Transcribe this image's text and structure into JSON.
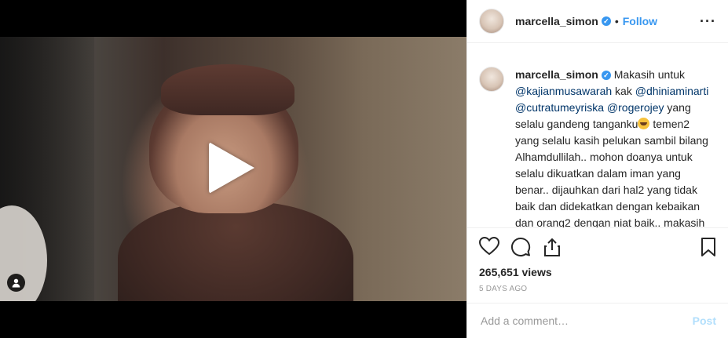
{
  "post": {
    "username": "marcella_simon",
    "follow_label": "Follow",
    "separator": "•",
    "more_label": "···",
    "caption_prefix": "Makasih untuk",
    "mentions": [
      "@kajianmusawarah",
      "@dhiniaminarti",
      "@cutratumeyriska",
      "@rogerojey"
    ],
    "caption_kak": "kak",
    "caption_mid": "yang selalu gandeng tanganku",
    "caption_rest": "temen2 yang selalu kasih pelukan sambil bilang Alhamdullilah.. mohon doanya untuk selalu dikuatkan dalam iman yang benar.. dijauhkan dari hal2 yang tidak baik dan didekatkan dengan kebaikan dan orang2 dengan niat baik.. makasih",
    "views": "265,651 views",
    "timestamp": "5 DAYS AGO",
    "comment_placeholder": "Add a comment…",
    "post_label": "Post",
    "icons": [
      "heart-icon",
      "comment-icon",
      "share-icon",
      "bookmark-icon",
      "play-icon",
      "user-tag-icon",
      "verified-badge-icon"
    ],
    "colors": {
      "link": "#3897f0",
      "mention": "#003569",
      "muted": "#999999",
      "post_disabled": "#b2dffc"
    }
  }
}
